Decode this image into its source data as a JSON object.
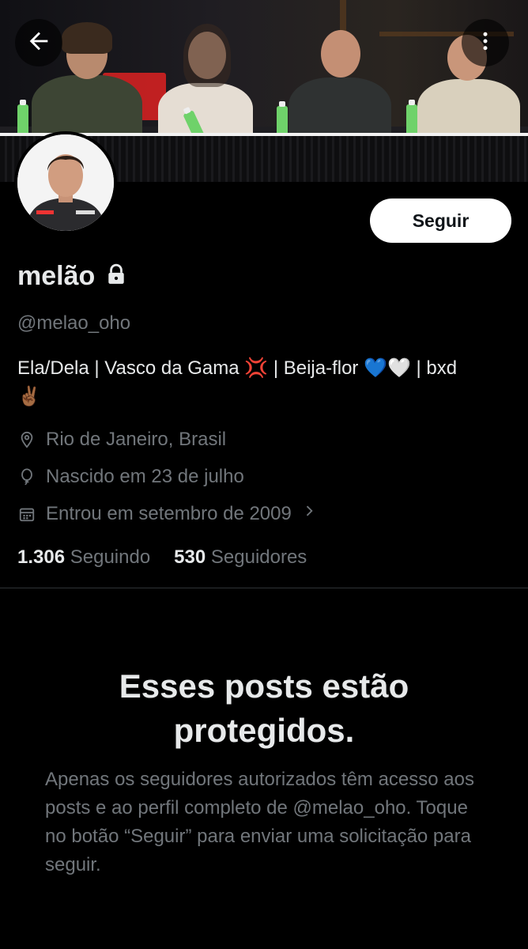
{
  "header": {
    "back_icon": "arrow-left-icon",
    "more_icon": "more-vertical-icon"
  },
  "profile": {
    "display_name": "melão",
    "lock_icon": "lock-icon",
    "handle": "@melao_oho",
    "bio_line1": "Ela/Dela | Vasco da Gama 💢 | Beija-flor 💙🤍 | bxd",
    "bio_line2": "✌🏾",
    "location": "Rio de Janeiro, Brasil",
    "birthday": "Nascido em 23 de julho",
    "joined": "Entrou em setembro de 2009",
    "following_count": "1.306",
    "following_label": "Seguindo",
    "followers_count": "530",
    "followers_label": "Seguidores"
  },
  "actions": {
    "follow_label": "Seguir"
  },
  "protected": {
    "title_line1": "Esses posts estão",
    "title_line2": "protegidos.",
    "message": "Apenas os seguidores autorizados têm acesso aos posts e ao perfil completo de @melao_oho. Toque no botão “Seguir” para enviar uma solicitação para seguir."
  },
  "colors": {
    "background": "#000000",
    "text_primary": "#e7e9ea",
    "text_secondary": "#71767b",
    "follow_button_bg": "#ffffff",
    "divider": "#2f3336"
  }
}
